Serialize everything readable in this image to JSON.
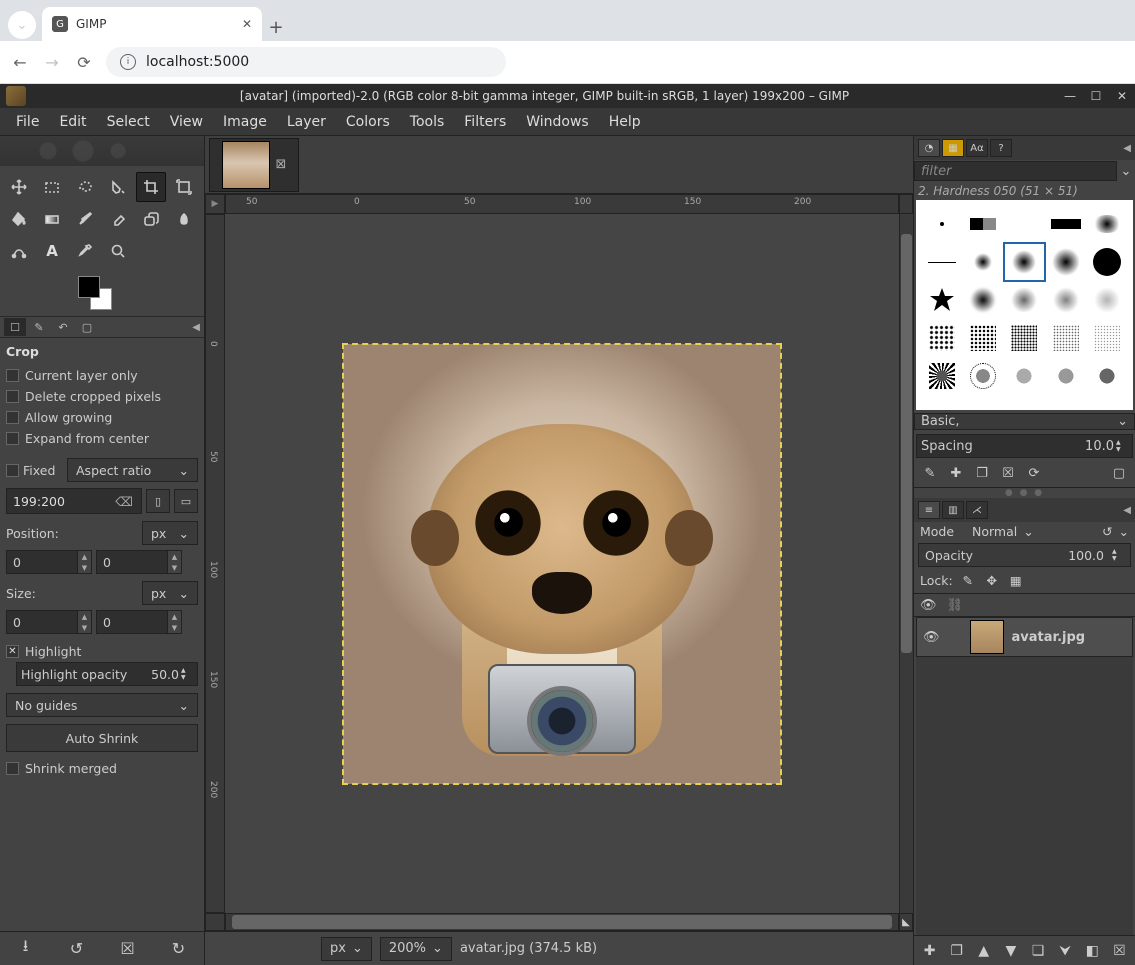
{
  "browser": {
    "tab_title": "GIMP",
    "url": "localhost:5000"
  },
  "window": {
    "title": "[avatar] (imported)-2.0 (RGB color 8-bit gamma integer, GIMP built-in sRGB, 1 layer) 199x200 – GIMP"
  },
  "menus": [
    "File",
    "Edit",
    "Select",
    "View",
    "Image",
    "Layer",
    "Colors",
    "Tools",
    "Filters",
    "Windows",
    "Help"
  ],
  "tool_options": {
    "title": "Crop",
    "chk_current_layer": "Current layer only",
    "chk_delete_cropped": "Delete cropped pixels",
    "chk_allow_growing": "Allow growing",
    "chk_expand_center": "Expand from center",
    "fixed_label": "Fixed",
    "fixed_mode": "Aspect ratio",
    "ratio_value": "199:200",
    "position_label": "Position:",
    "unit_px": "px",
    "pos_x": "0",
    "pos_y": "0",
    "size_label": "Size:",
    "size_w": "0",
    "size_h": "0",
    "highlight_label": "Highlight",
    "highlight_opacity_label": "Highlight opacity",
    "highlight_opacity_value": "50.0",
    "guides_label": "No guides",
    "auto_shrink": "Auto Shrink",
    "shrink_merged": "Shrink merged"
  },
  "ruler": {
    "h_marks": [
      "50",
      "0",
      "50",
      "100",
      "150",
      "200"
    ],
    "v_marks": [
      "0",
      "50",
      "100",
      "150",
      "200"
    ]
  },
  "status": {
    "unit": "px",
    "zoom": "200%",
    "file_info": "avatar.jpg (374.5 kB)"
  },
  "brush_panel": {
    "filter_placeholder": "filter",
    "selected_label": "2. Hardness 050 (51 × 51)",
    "preset": "Basic,",
    "spacing_label": "Spacing",
    "spacing_value": "10.0"
  },
  "layers": {
    "mode_label": "Mode",
    "mode_value": "Normal",
    "opacity_label": "Opacity",
    "opacity_value": "100.0",
    "lock_label": "Lock:",
    "layer_name": "avatar.jpg"
  }
}
